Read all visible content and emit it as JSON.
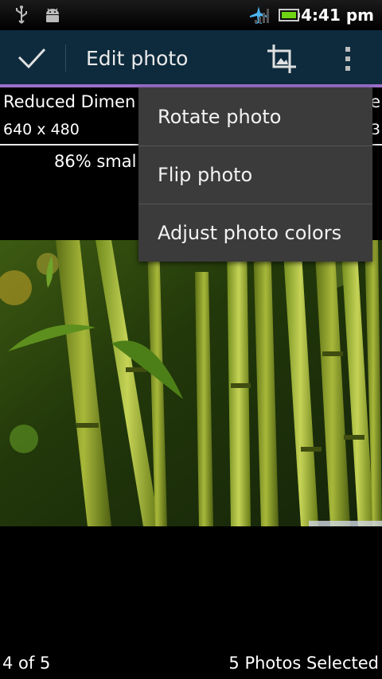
{
  "status_bar": {
    "time": "4:41 pm",
    "icons": [
      "usb-icon",
      "android-debug-icon",
      "airplane-mode-icon",
      "signal-icon",
      "battery-icon"
    ]
  },
  "action_bar": {
    "title": "Edit photo",
    "icons": [
      "done-check-icon",
      "crop-icon",
      "overflow-menu-icon"
    ],
    "accent_color": "#9b6fc9",
    "background_color": "#0e2b3d"
  },
  "info": {
    "title_partial": "Reduced Dimen",
    "dimensions": "640 x 480",
    "right_title_fragment": "e",
    "right_dims_fragment": "3",
    "size_reduction_partial": "86% smal"
  },
  "menu": {
    "items": [
      {
        "label": "Rotate photo"
      },
      {
        "label": "Flip photo"
      },
      {
        "label": "Adjust photo colors"
      }
    ]
  },
  "footer": {
    "position": "4 of 5",
    "selection": "5 Photos Selected"
  }
}
